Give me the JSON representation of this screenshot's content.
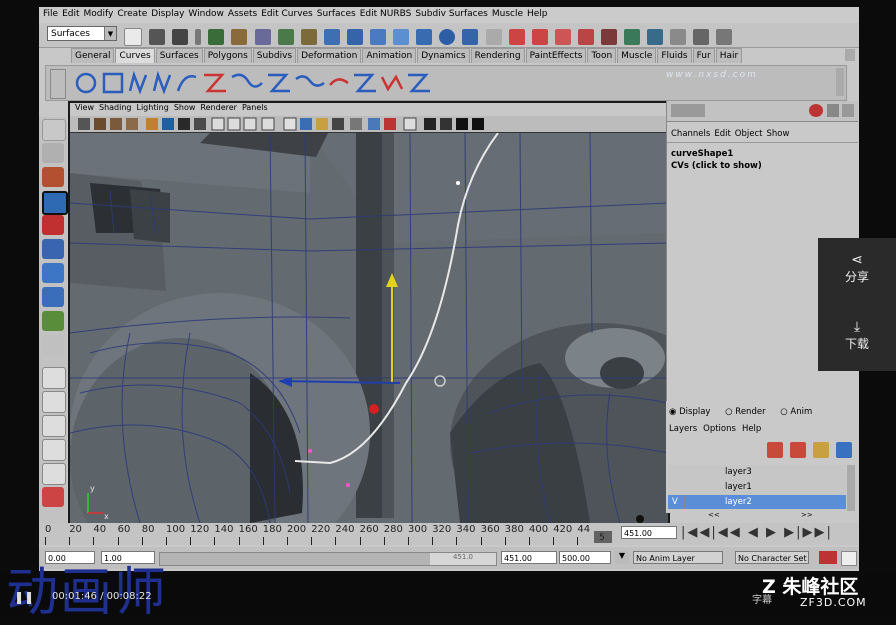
{
  "menubar": {
    "items": [
      "File",
      "Edit",
      "Modify",
      "Create",
      "Display",
      "Window",
      "Assets",
      "Edit Curves",
      "Surfaces",
      "Edit NURBS",
      "Subdiv Surfaces",
      "Muscle",
      "Help"
    ]
  },
  "statusline": {
    "menu_set": "Surfaces"
  },
  "shelf": {
    "tabs": [
      "General",
      "Curves",
      "Surfaces",
      "Polygons",
      "Subdivs",
      "Deformation",
      "Animation",
      "Dynamics",
      "Rendering",
      "PaintEffects",
      "Toon",
      "Muscle",
      "Fluids",
      "Fur",
      "Hair"
    ],
    "active_tab": "Curves"
  },
  "panel": {
    "menus": [
      "View",
      "Shading",
      "Lighting",
      "Show",
      "Renderer",
      "Panels"
    ]
  },
  "channelbox": {
    "menus": [
      "Channels",
      "Edit",
      "Object",
      "Show"
    ],
    "object_name": "curveShape1",
    "cvs_label": "CVs (click to show)"
  },
  "layers": {
    "display_label": "Display",
    "render_label": "Render",
    "anim_label": "Anim",
    "menus": [
      "Layers",
      "Options",
      "Help"
    ],
    "items": [
      {
        "name": "layer3",
        "selected": false,
        "v": ""
      },
      {
        "name": "layer1",
        "selected": false,
        "v": ""
      },
      {
        "name": "layer2",
        "selected": true,
        "v": "V"
      }
    ]
  },
  "timeline": {
    "ticks": [
      "0",
      "20",
      "40",
      "60",
      "80",
      "100",
      "120",
      "140",
      "160",
      "180",
      "200",
      "220",
      "240",
      "260",
      "280",
      "300",
      "320",
      "340",
      "360",
      "380",
      "400",
      "420",
      "44"
    ],
    "current_frame": "451.00",
    "end_tick": "5"
  },
  "rangebar": {
    "start": "0.00",
    "start2": "1.00",
    "current": "451.00",
    "end": "451.00",
    "end2": "500.00",
    "anim_layer": "No Anim Layer",
    "char_set": "No Character Set",
    "slider_label": "451.0"
  },
  "side_actions": {
    "share": "分享",
    "download": "下载"
  },
  "watermark": {
    "site": "www.nxsd.com",
    "brand": "朱峰社区",
    "brand_url": "ZF3D.COM"
  },
  "player": {
    "title": "动画师",
    "time_current": "00:01:46",
    "time_total": "00:08:22",
    "sub": "字幕"
  },
  "colors": {
    "selected_layer": "#5a8fd8",
    "viewport_bg": "#636a70",
    "dark_bg": "#0b0b0b"
  }
}
